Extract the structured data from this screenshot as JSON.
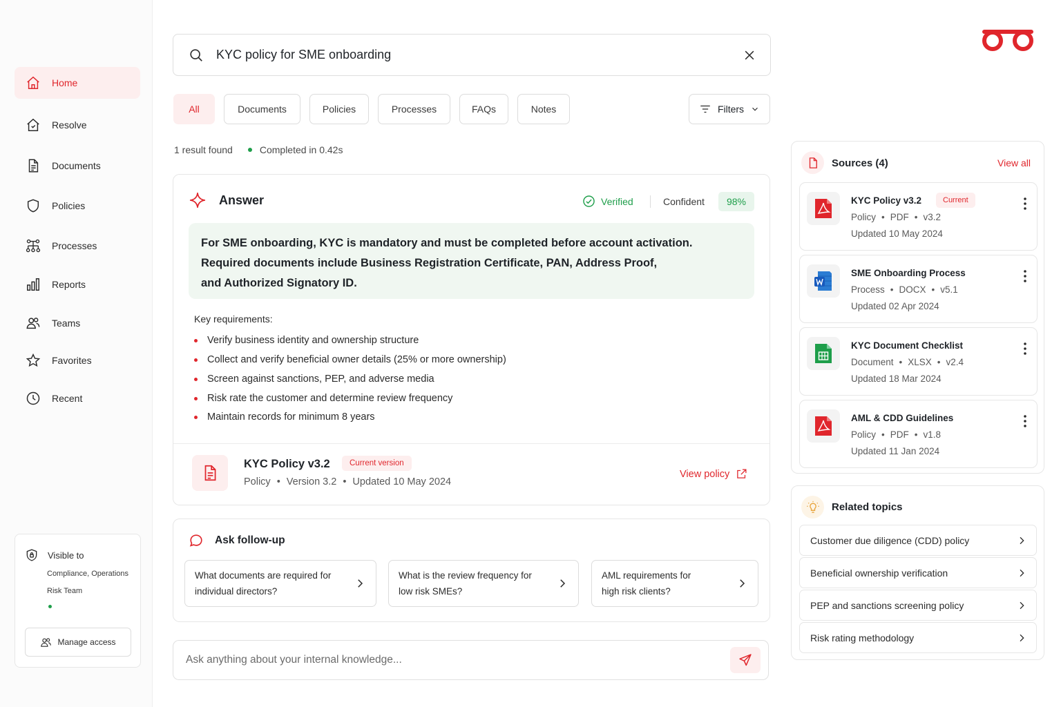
{
  "sidebar": {
    "items": [
      {
        "label": "Home",
        "icon": "home-icon",
        "active": true
      },
      {
        "label": "Resolve",
        "icon": "resolve-icon"
      },
      {
        "label": "Documents",
        "icon": "document-icon"
      },
      {
        "label": "Policies",
        "icon": "shield-icon"
      },
      {
        "label": "Processes",
        "icon": "process-icon"
      },
      {
        "label": "Reports",
        "icon": "bar-chart-icon"
      },
      {
        "label": "Teams",
        "icon": "users-icon"
      },
      {
        "label": "Favorites",
        "icon": "star-icon"
      },
      {
        "label": "Recent",
        "icon": "clock-icon"
      }
    ],
    "access": {
      "title": "Visible to",
      "line1": "Compliance, Operations",
      "line2": "Risk Team",
      "manage_label": "Manage access"
    }
  },
  "search": {
    "query": "KYC policy for SME onboarding"
  },
  "tabs": [
    {
      "label": "All",
      "active": true
    },
    {
      "label": "Documents"
    },
    {
      "label": "Policies"
    },
    {
      "label": "Processes"
    },
    {
      "label": "FAQs"
    },
    {
      "label": "Notes"
    }
  ],
  "filters_label": "Filters",
  "results": {
    "count_text": "1 result found",
    "time_text": "Completed in 0.42s"
  },
  "answer": {
    "title": "Answer",
    "verified_label": "Verified",
    "confident_label": "Confident",
    "confidence_pct": "98%",
    "summary_lines": [
      "For SME onboarding, KYC is mandatory and must be completed before account activation.",
      "Required documents include Business Registration Certificate, PAN, Address Proof,",
      "and Authorized Signatory ID."
    ],
    "key_title": "Key requirements:",
    "requirements": [
      "Verify business identity and ownership structure",
      "Collect and verify beneficial owner details (25% or more ownership)",
      "Screen against sanctions, PEP, and adverse media",
      "Risk rate the customer and determine review frequency",
      "Maintain records for minimum 8 years"
    ],
    "policy": {
      "title": "KYC Policy v3.2",
      "badge": "Current version",
      "type": "Policy",
      "version": "Version 3.2",
      "updated": "Updated 10 May 2024",
      "view_label": "View policy"
    }
  },
  "followup": {
    "title": "Ask follow-up",
    "questions": [
      {
        "line1": "What documents are required for",
        "line2": "individual directors?"
      },
      {
        "line1": "What is the review frequency for",
        "line2": "low risk SMEs?"
      },
      {
        "line1": "AML requirements for",
        "line2": "high risk clients?"
      }
    ]
  },
  "ask": {
    "placeholder": "Ask anything about your internal knowledge..."
  },
  "sources": {
    "title": "Sources (4)",
    "view_all": "View all",
    "items": [
      {
        "name": "KYC Policy v3.2",
        "badge": "Current",
        "type": "Policy",
        "format": "PDF",
        "version": "v3.2",
        "updated": "Updated 10 May 2024",
        "icon": "pdf-file-icon"
      },
      {
        "name": "SME Onboarding Process",
        "type": "Process",
        "format": "DOCX",
        "version": "v5.1",
        "updated": "Updated 02 Apr 2024",
        "icon": "word-file-icon"
      },
      {
        "name": "KYC Document Checklist",
        "type": "Document",
        "format": "XLSX",
        "version": "v2.4",
        "updated": "Updated 18 Mar 2024",
        "icon": "sheet-file-icon"
      },
      {
        "name": "AML & CDD Guidelines",
        "type": "Policy",
        "format": "PDF",
        "version": "v1.8",
        "updated": "Updated 11 Jan 2024",
        "icon": "pdf-file-icon"
      }
    ]
  },
  "related": {
    "title": "Related topics",
    "items": [
      "Customer due diligence (CDD) policy",
      "Beneficial ownership verification",
      "PEP and sanctions screening policy",
      "Risk rating methodology"
    ]
  },
  "colors": {
    "accent": "#e0262c",
    "accent_soft": "#fdeeee",
    "success": "#1e9e4a",
    "success_soft": "#f0f7f1"
  }
}
